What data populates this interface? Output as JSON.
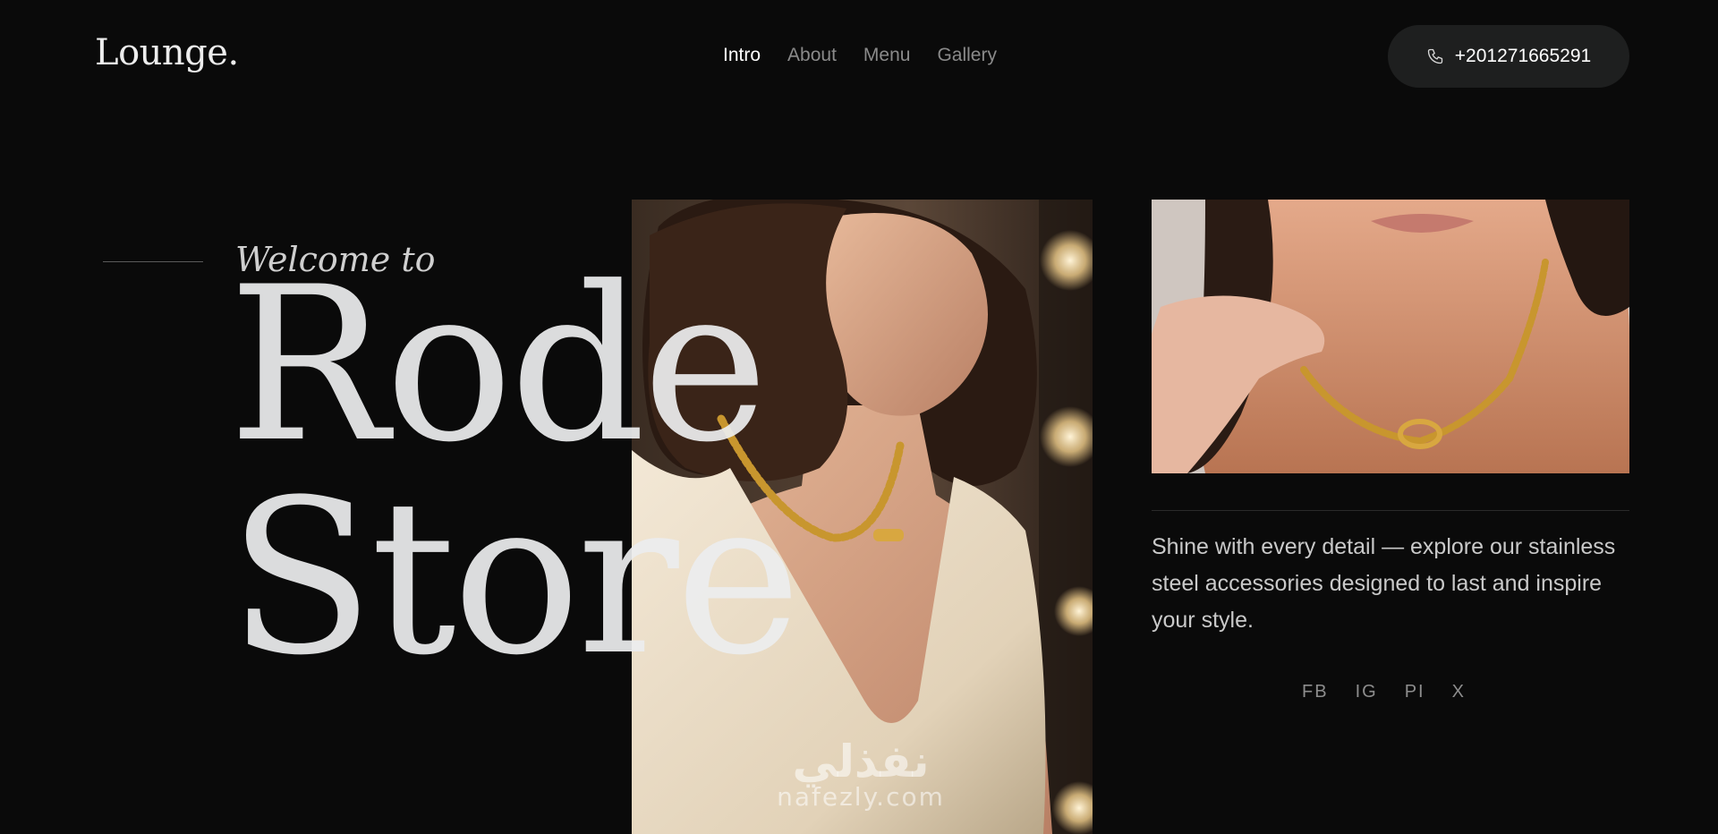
{
  "header": {
    "logo": "Lounge.",
    "nav": [
      {
        "label": "Intro",
        "active": true
      },
      {
        "label": "About",
        "active": false
      },
      {
        "label": "Menu",
        "active": false
      },
      {
        "label": "Gallery",
        "active": false
      }
    ],
    "phone": {
      "icon": "phone-icon",
      "number": "+201271665291"
    }
  },
  "hero": {
    "welcome": "Welcome to",
    "title_line1": "Rode",
    "title_line2": "Store",
    "main_image": "woman-in-white-dress-with-gold-chain-necklace",
    "side_image": "close-up-gold-chain-necklace-on-neck"
  },
  "aside": {
    "tagline": "Shine with every detail — explore our stainless steel accessories designed to last and inspire your style.",
    "socials": [
      "FB",
      "IG",
      "PI",
      "X"
    ]
  },
  "watermark": {
    "arabic": "نفذلي",
    "latin": "nafezly.com"
  },
  "colors": {
    "background": "#0a0a0a",
    "button": "#1e1f1f",
    "gold": "#c8962e"
  }
}
